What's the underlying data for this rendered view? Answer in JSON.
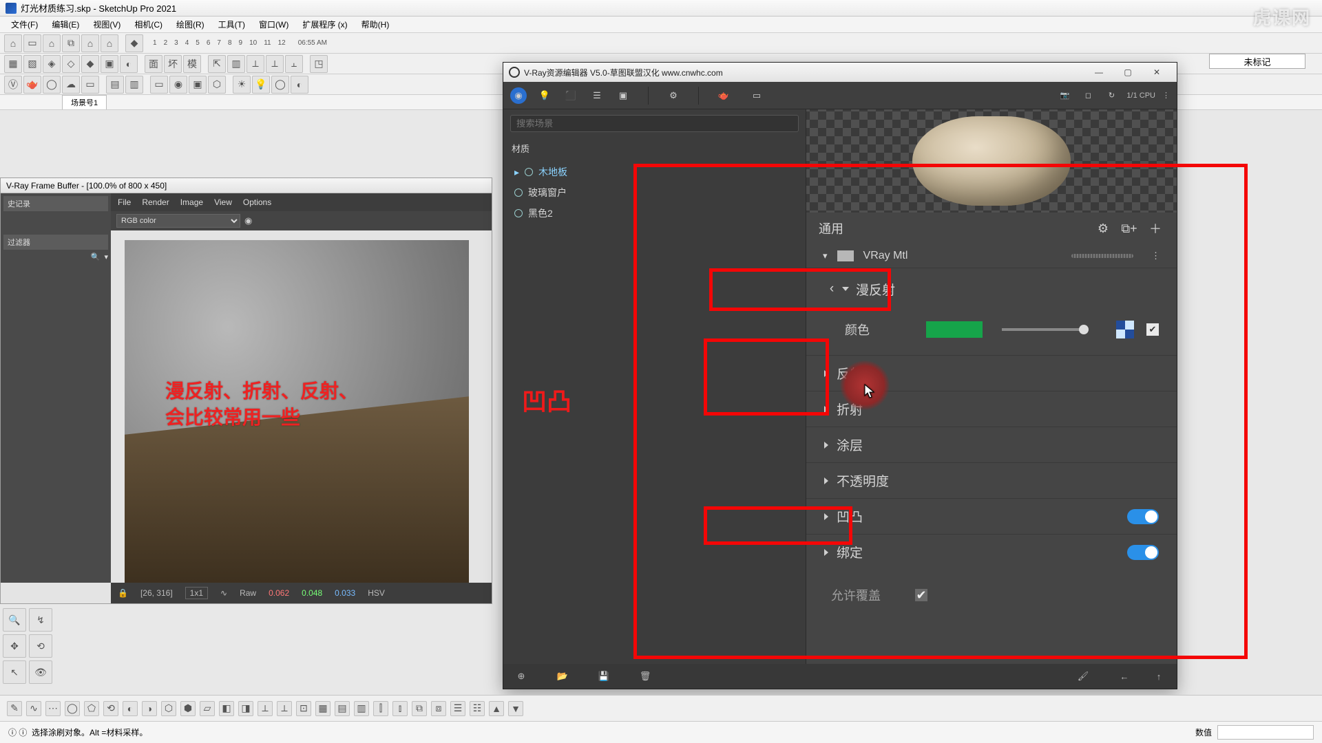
{
  "app": {
    "title": "灯光材质练习.skp - SketchUp Pro 2021",
    "menus": [
      "文件(F)",
      "编辑(E)",
      "视图(V)",
      "相机(C)",
      "绘图(R)",
      "工具(T)",
      "窗口(W)",
      "扩展程序 (x)",
      "帮助(H)"
    ],
    "time_label": "06:55 AM",
    "tag_dropdown": "未标记",
    "scene_tab": "场景号1"
  },
  "timeline_nums": [
    "1",
    "2",
    "3",
    "4",
    "5",
    "6",
    "7",
    "8",
    "9",
    "10",
    "11",
    "12"
  ],
  "vfb": {
    "title": "V-Ray Frame Buffer - [100.0% of 800 x 450]",
    "side_header_1": "史记录",
    "side_header_2": "过滤器",
    "menus": [
      "File",
      "Render",
      "Image",
      "View",
      "Options"
    ],
    "color_mode": "RGB color",
    "caption_l1": "漫反射、折射、反射、",
    "caption_l2": "会比较常用一些",
    "coords": "[26, 316]",
    "grid_label": "1x1",
    "raw_label": "Raw",
    "r": "0.062",
    "g": "0.048",
    "b": "0.033",
    "hsv": "HSV"
  },
  "vae": {
    "title": "V-Ray资源编辑器 V5.0-草图联盟汉化 www.cnwhc.com",
    "search_placeholder": "搜索场景",
    "category": "材质",
    "tree": [
      "木地板",
      "玻璃窗户",
      "黑色2"
    ],
    "panel_title": "通用",
    "material_name": "VRay Mtl",
    "sections": {
      "diffuse": "漫反射",
      "color_label": "颜色",
      "reflect": "反射",
      "refract": "折射",
      "coat": "涂层",
      "opacity": "不透明度",
      "bump": "凹凸",
      "bind": "绑定",
      "override": "允许覆盖"
    },
    "cpu_label": "1/1  CPU"
  },
  "bump_label": "凹凸",
  "status": {
    "text": "选择涂刷对象。Alt =材料采样。",
    "measure_label": "数值"
  },
  "watermark": "虎课网"
}
